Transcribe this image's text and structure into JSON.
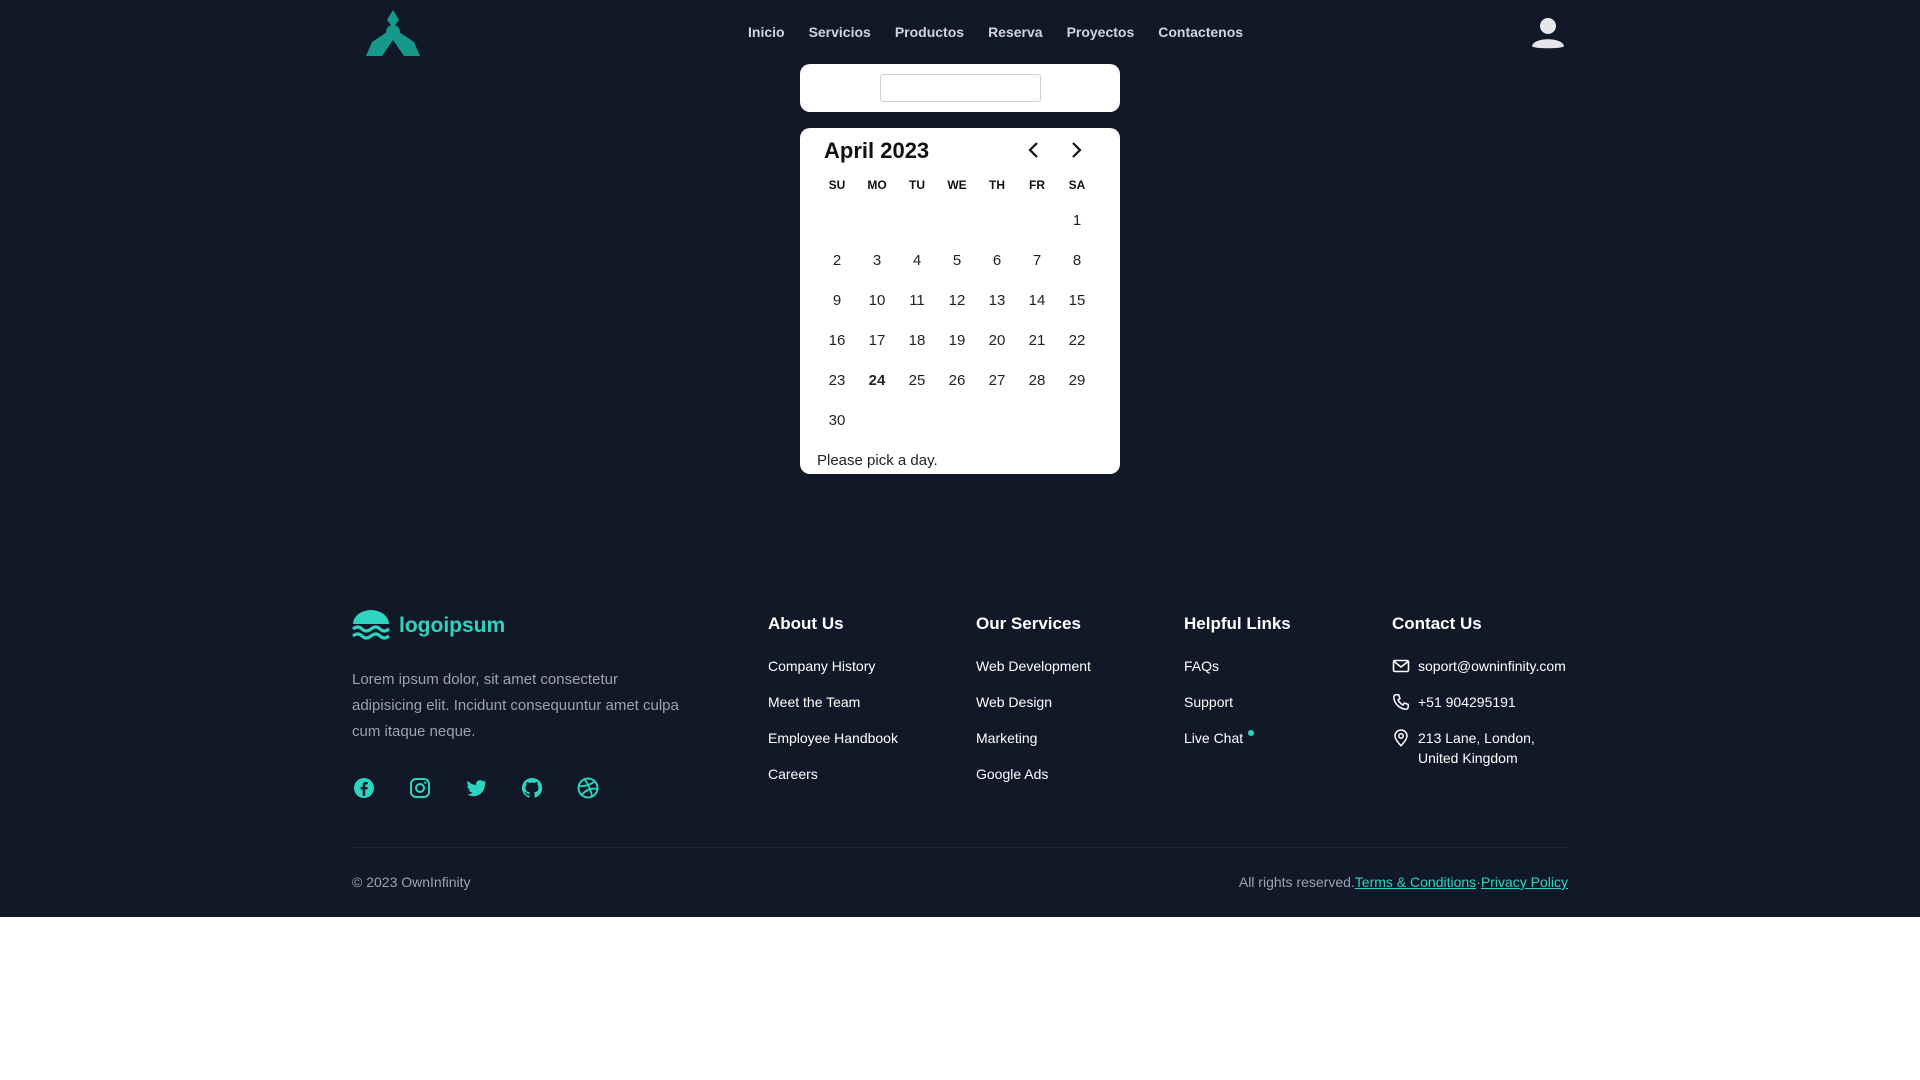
{
  "header": {
    "nav": [
      "Inicio",
      "Servicios",
      "Productos",
      "Reserva",
      "Proyectos",
      "Contactenos"
    ]
  },
  "date_input": {
    "value": ""
  },
  "calendar": {
    "title": "April 2023",
    "weekdays": [
      "SU",
      "MO",
      "TU",
      "WE",
      "TH",
      "FR",
      "SA"
    ],
    "leading_blanks": 6,
    "days": [
      "1",
      "2",
      "3",
      "4",
      "5",
      "6",
      "7",
      "8",
      "9",
      "10",
      "11",
      "12",
      "13",
      "14",
      "15",
      "16",
      "17",
      "18",
      "19",
      "20",
      "21",
      "22",
      "23",
      "24",
      "25",
      "26",
      "27",
      "28",
      "29",
      "30"
    ],
    "today": "24",
    "footer": "Please pick a day."
  },
  "footer": {
    "brand": "logoipsum",
    "about": "Lorem ipsum dolor, sit amet consectetur adipisicing elit. Incidunt consequuntur amet culpa cum itaque neque.",
    "socials": [
      "facebook-icon",
      "instagram-icon",
      "twitter-icon",
      "github-icon",
      "dribbble-icon"
    ],
    "columns": {
      "about": {
        "title": "About Us",
        "links": [
          "Company History",
          "Meet the Team",
          "Employee Handbook",
          "Careers"
        ]
      },
      "services": {
        "title": "Our Services",
        "links": [
          "Web Development",
          "Web Design",
          "Marketing",
          "Google Ads"
        ]
      },
      "helpful": {
        "title": "Helpful Links",
        "links": [
          "FAQs",
          "Support",
          "Live Chat"
        ]
      },
      "contact": {
        "title": "Contact Us",
        "email": "soport@owninfinity.com",
        "phone": "+51 904295191",
        "address_line1": "213 Lane, London,",
        "address_line2": "United Kingdom"
      }
    },
    "copyright": "© 2023 OwnInfinity",
    "rights": "All rights reserved.",
    "terms": "Terms & Conditions",
    "sep": "·",
    "privacy": "Privacy Policy"
  },
  "colors": {
    "background": "#111827",
    "accent": "#2dd4bf",
    "logo": "#14998a",
    "muted": "#9ca3af"
  }
}
